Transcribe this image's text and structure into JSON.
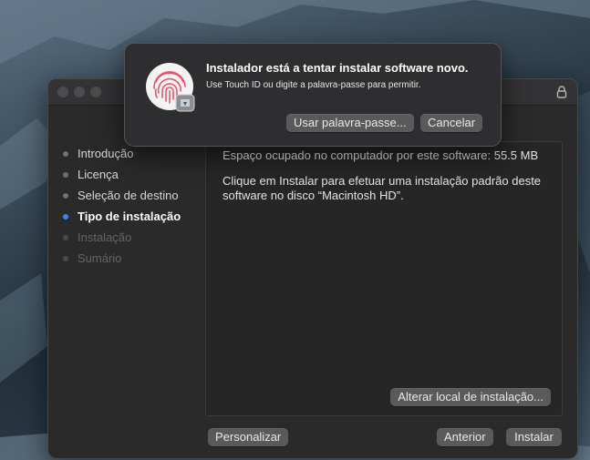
{
  "window": {
    "sidebar": {
      "steps": [
        {
          "label": "Introdução",
          "state": "done"
        },
        {
          "label": "Licença",
          "state": "done"
        },
        {
          "label": "Seleção de destino",
          "state": "done"
        },
        {
          "label": "Tipo de instalação",
          "state": "active"
        },
        {
          "label": "Instalação",
          "state": "disabled"
        },
        {
          "label": "Sumário",
          "state": "disabled"
        }
      ]
    },
    "content": {
      "space_text": "Espaço ocupado no computador por este software: 55.5 MB",
      "install_text": "Clique em Instalar para efetuar uma instalação padrão deste software no disco “Macintosh HD”."
    },
    "buttons": {
      "change_location": "Alterar local de instalação...",
      "customize": "Personalizar",
      "back": "Anterior",
      "install": "Instalar"
    }
  },
  "auth_dialog": {
    "title": "Instalador está a tentar instalar software novo.",
    "subtitle": "Use Touch ID ou digite a palavra-passe para permitir.",
    "use_password_label": "Usar palavra-passe...",
    "cancel_label": "Cancelar",
    "icon": "touch-id-fingerprint-icon"
  },
  "colors": {
    "accent": "#3b82f6",
    "fingerprint": "#e8566b"
  }
}
